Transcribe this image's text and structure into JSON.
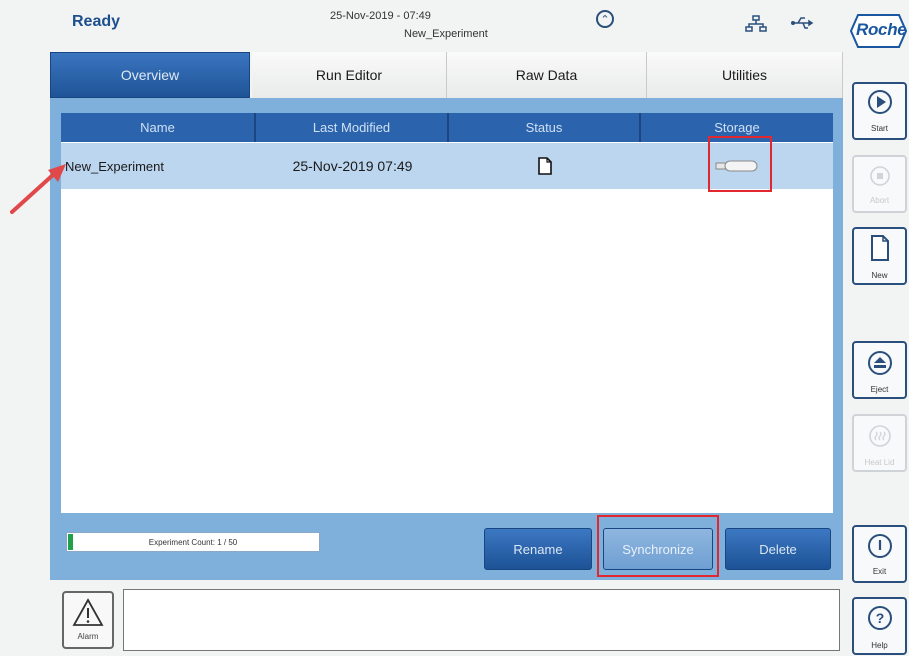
{
  "header": {
    "status": "Ready",
    "datetime": "25-Nov-2019 - 07:49",
    "experiment": "New_Experiment",
    "brand": "Roche"
  },
  "tabs": [
    {
      "label": "Overview",
      "active": true
    },
    {
      "label": "Run Editor",
      "active": false
    },
    {
      "label": "Raw Data",
      "active": false
    },
    {
      "label": "Utilities",
      "active": false
    }
  ],
  "table": {
    "columns": [
      "Name",
      "Last Modified",
      "Status",
      "Storage"
    ],
    "rows": [
      {
        "name": "New_Experiment",
        "modified": "25-Nov-2019 07:49",
        "status_icon": "file-icon",
        "storage_icon": "usb-stick-icon"
      }
    ]
  },
  "footer": {
    "count": "Experiment Count: 1 / 50",
    "count_fraction": 0.02,
    "buttons": {
      "rename": "Rename",
      "synchronize": "Synchronize",
      "delete": "Delete"
    },
    "alarm": "Alarm"
  },
  "sidebar": [
    {
      "label": "Start",
      "icon": "play-icon",
      "enabled": true
    },
    {
      "label": "Abort",
      "icon": "stop-icon",
      "enabled": false
    },
    {
      "label": "New",
      "icon": "new-file-icon",
      "enabled": true
    },
    {
      "label": "Eject",
      "icon": "eject-icon",
      "enabled": true
    },
    {
      "label": "Heat Lid",
      "icon": "heat-icon",
      "enabled": false
    },
    {
      "label": "Exit",
      "icon": "power-icon",
      "enabled": true
    },
    {
      "label": "Help",
      "icon": "help-icon",
      "enabled": true
    }
  ],
  "colors": {
    "accent": "#2b64ac",
    "selected_row": "#bcd6f0",
    "highlight": "#e0282e",
    "progress": "#21a04a"
  }
}
